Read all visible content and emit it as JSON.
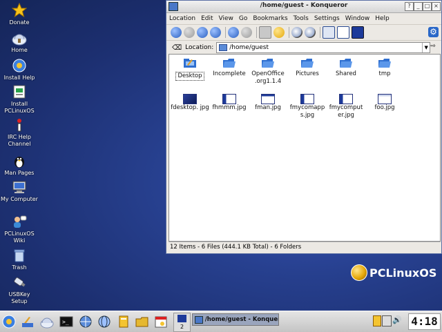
{
  "desktop": {
    "icons": [
      {
        "label": "Donate",
        "icon": "star-icon"
      },
      {
        "label": "Home",
        "icon": "home-icon"
      },
      {
        "label": "Install Help",
        "icon": "install-help-icon"
      },
      {
        "label": "Install PCLinuxOS",
        "icon": "install-icon"
      },
      {
        "label": "IRC Help Channel",
        "icon": "irc-icon"
      },
      {
        "label": "Man Pages",
        "icon": "tux-icon"
      },
      {
        "label": "My Computer",
        "icon": "computer-icon"
      },
      {
        "label": "PCLinuxOS Wiki",
        "icon": "wiki-icon"
      },
      {
        "label": "Trash",
        "icon": "trash-icon"
      },
      {
        "label": "USBKey Setup",
        "icon": "usbkey-icon"
      }
    ],
    "logo_text": "PCLinuxOS"
  },
  "window": {
    "title": "/home/guest - Konqueror",
    "menu": [
      "Location",
      "Edit",
      "View",
      "Go",
      "Bookmarks",
      "Tools",
      "Settings",
      "Window",
      "Help"
    ],
    "location_label": "Location:",
    "location_value": "/home/guest",
    "items": [
      {
        "name": "Desktop",
        "type": "desktop",
        "selected": true
      },
      {
        "name": "Incomplete",
        "type": "folder"
      },
      {
        "name": "OpenOffice .org1.1.4",
        "type": "folder"
      },
      {
        "name": "Pictures",
        "type": "folder"
      },
      {
        "name": "Shared",
        "type": "folder"
      },
      {
        "name": "tmp",
        "type": "folder"
      },
      {
        "name": "fdesktop. jpg",
        "type": "image-dark"
      },
      {
        "name": "fhmmm.jpg",
        "type": "image"
      },
      {
        "name": "fman.jpg",
        "type": "image"
      },
      {
        "name": "fmycomapp s.jpg",
        "type": "image"
      },
      {
        "name": "fmycomput er.jpg",
        "type": "image"
      },
      {
        "name": "foo.jpg",
        "type": "image-light"
      }
    ],
    "status": "12 Items - 6 Files (444.1 KB Total) - 6 Folders"
  },
  "taskbar": {
    "desktop_number": "2",
    "task_label": "/home/guest - Konquer",
    "clock": "4:18"
  },
  "colors": {
    "desktop_bg": "#27408f",
    "folder_blue": "#2f6fd0",
    "accent": "#1d3a9a"
  }
}
